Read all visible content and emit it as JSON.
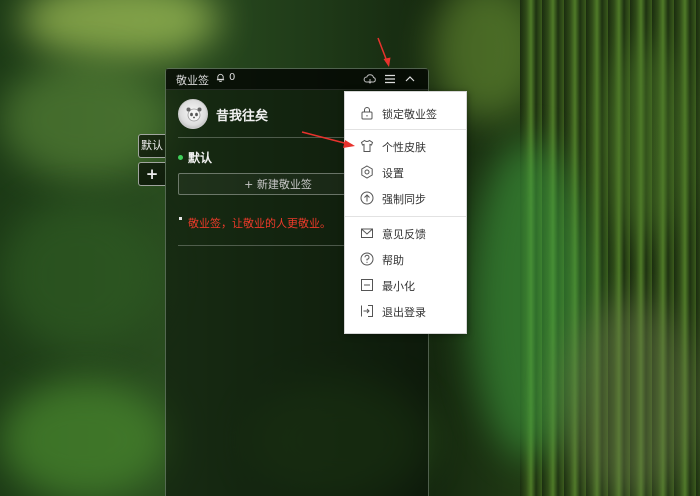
{
  "app": {
    "title": "敬业签",
    "notification_count": "0",
    "username": "昔我往矣",
    "category": "默认",
    "new_button_label": "+ 新建敬业签",
    "note_text": "敬业签，让敬业的人更敬业。",
    "side_tabs": [
      "默认",
      "+"
    ]
  },
  "menu": {
    "items": [
      {
        "label": "锁定敬业签",
        "icon": "lock-icon"
      },
      {
        "label": "个性皮肤",
        "icon": "shirt-icon"
      },
      {
        "label": "设置",
        "icon": "settings-icon"
      },
      {
        "label": "强制同步",
        "icon": "sync-arrow-icon"
      },
      {
        "label": "意见反馈",
        "icon": "mail-icon"
      },
      {
        "label": "帮助",
        "icon": "help-icon"
      },
      {
        "label": "最小化",
        "icon": "minimize-icon"
      },
      {
        "label": "退出登录",
        "icon": "logout-icon"
      }
    ]
  },
  "colors": {
    "accent_green": "#3fd05a",
    "note_red": "#ee3a2a",
    "annotation_arrow": "#e8322d"
  }
}
